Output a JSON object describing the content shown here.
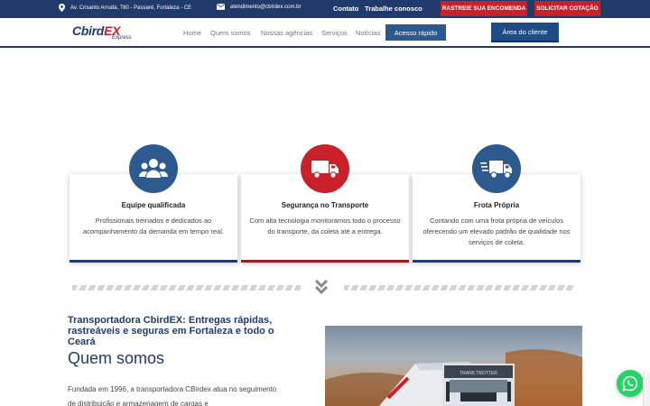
{
  "topbar": {
    "address": "Av. Crisanto Arruda, 780 - Passaré, Fortaleza - CE",
    "email": "atendimento@cbirdex.com.br",
    "links": [
      "Contato",
      "Trabalhe conosco"
    ],
    "track_button": "RASTREIE SUA ENCOMENDA",
    "quote_button": "SOLICITAR COTAÇÃO"
  },
  "header": {
    "logo_main": "Cbird",
    "logo_accent": "EX",
    "logo_sub": "Express",
    "nav": [
      "Home",
      "Quem somos",
      "Nossas agências",
      "Serviços",
      "Notícias"
    ],
    "quick_access": "Acesso rápido",
    "client_area": "Área do cliente"
  },
  "features": [
    {
      "icon": "users-icon",
      "title": "Equipe qualificada",
      "description": "Profissionais treinados e dedicados ao acompanhamento da demanda em tempo real.",
      "color": "#2c5a8f"
    },
    {
      "icon": "truck-icon",
      "title": "Segurança no Transporte",
      "description": "Com alta tecnologia monitoramos todo o processo do transporte, da coleta até a entrega.",
      "color": "#c9202a"
    },
    {
      "icon": "fast-truck-icon",
      "title": "Frota Própria",
      "description": "Contando com uma frota própria de veículos oferecendo um elevado padrão de qualidade nos serviços de coleta.",
      "color": "#2c5a8f"
    }
  ],
  "about": {
    "tagline": "Transportadora CbirdEX: Entregas rápidas, rastreáveis e seguras em Fortaleza e todo o Ceará",
    "title": "Quem somos",
    "text": "Fundada em 1996, a transportadora CBirdex atua no seguimento de distribuição e armazenagem de cargas e"
  },
  "photo_truck_text": "TRANS TROTTER",
  "colors": {
    "navy": "#1f3a6b",
    "red": "#c9202a",
    "blue": "#2c5a8f",
    "whatsapp": "#25d366"
  }
}
